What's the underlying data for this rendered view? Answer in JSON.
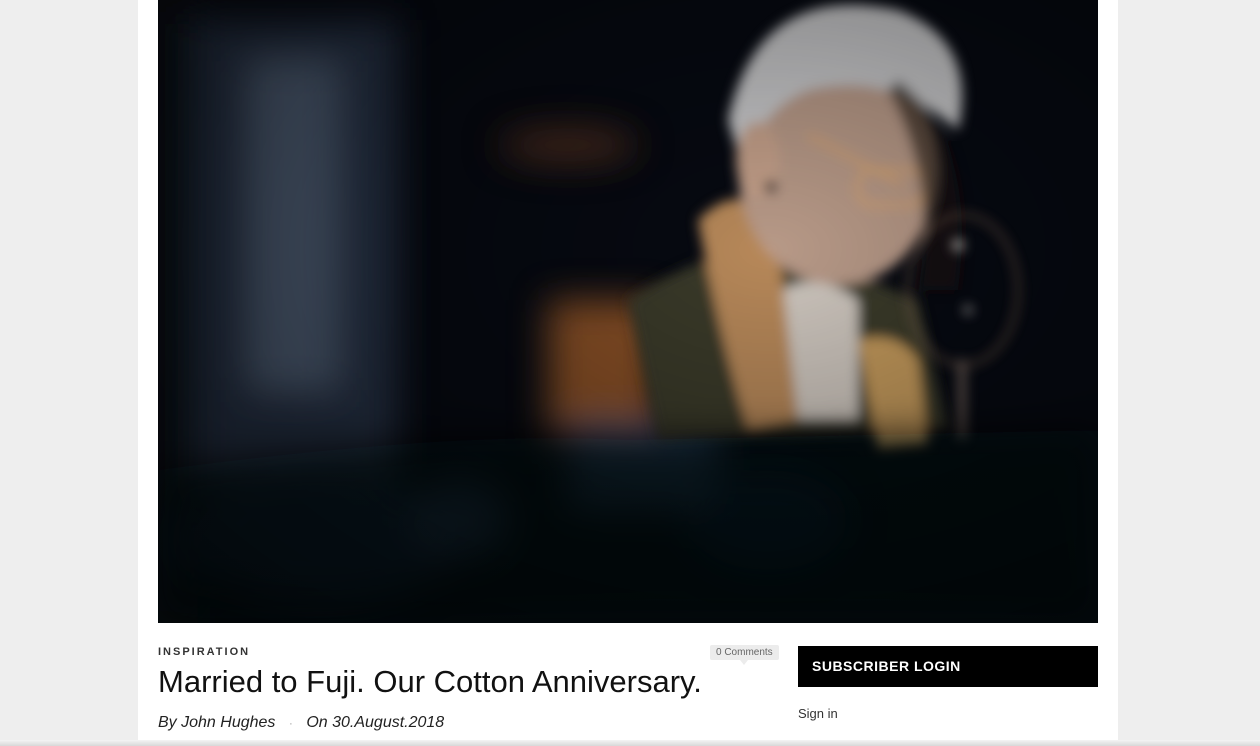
{
  "article": {
    "category": "INSPIRATION",
    "comments_label": "0 Comments",
    "title": "Married to Fuji. Our Cotton Anniversary.",
    "author": "By John Hughes",
    "separator": "·",
    "date": "On 30.August.2018"
  },
  "sidebar": {
    "widget_title": "SUBSCRIBER LOGIN",
    "signin_label": "Sign in"
  },
  "colors": {
    "page_background": "#eeeeee",
    "content_background": "#ffffff",
    "widget_header_background": "#000000",
    "comment_badge_background": "#ececec"
  }
}
